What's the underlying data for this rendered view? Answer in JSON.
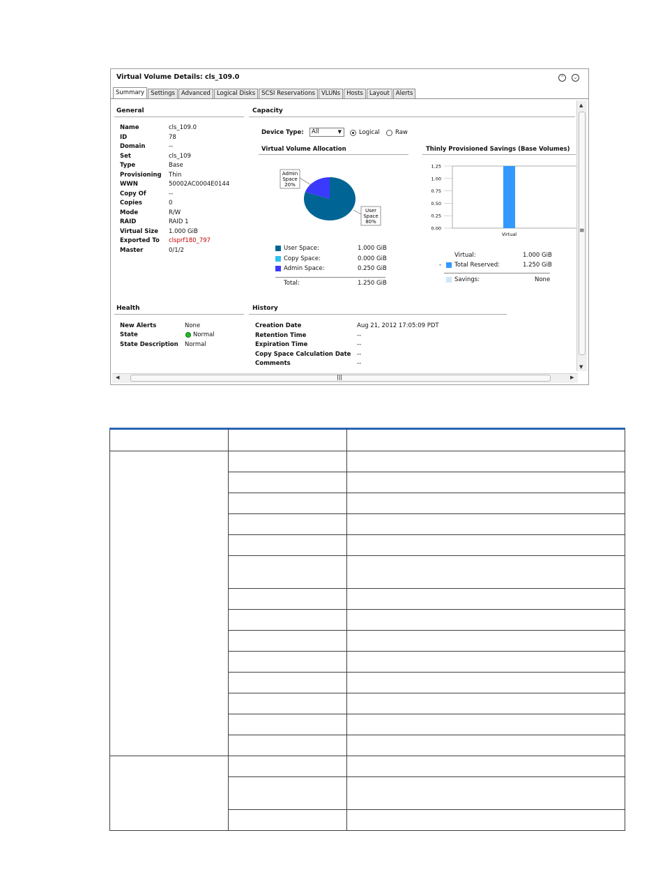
{
  "window": {
    "title": "Virtual Volume Details: cls_109.0",
    "tabs": [
      "Summary",
      "Settings",
      "Advanced",
      "Logical Disks",
      "SCSI Reservations",
      "VLUNs",
      "Hosts",
      "Layout",
      "Alerts"
    ],
    "active_tab": "Summary"
  },
  "general": {
    "title": "General",
    "rows": [
      {
        "label": "Name",
        "value": "cls_109.0"
      },
      {
        "label": "ID",
        "value": "78"
      },
      {
        "label": "Domain",
        "value": "--"
      },
      {
        "label": "Set",
        "value": "cls_109"
      },
      {
        "label": "Type",
        "value": "Base"
      },
      {
        "label": "Provisioning",
        "value": "Thin"
      },
      {
        "label": "WWN",
        "value": "50002AC0004E0144"
      },
      {
        "label": "Copy Of",
        "value": "--"
      },
      {
        "label": "Copies",
        "value": "0"
      },
      {
        "label": "Mode",
        "value": "R/W"
      },
      {
        "label": "RAID",
        "value": "RAID 1"
      },
      {
        "label": "Virtual Size",
        "value": "1.000 GiB"
      },
      {
        "label": "Exported To",
        "value": "clsprf180_797"
      },
      {
        "label": "Master",
        "value": "0/1/2"
      }
    ]
  },
  "capacity": {
    "title": "Capacity",
    "device_type_label": "Device Type:",
    "device_type_value": "All",
    "radio_logical": "Logical",
    "radio_raw": "Raw",
    "allocation_title": "Virtual Volume Allocation",
    "savings_title": "Thinly Provisioned Savings (Base Volumes)",
    "legend": [
      {
        "label": "User Space:",
        "value": "1.000 GiB",
        "color": "#006594"
      },
      {
        "label": "Copy Space:",
        "value": "0.000 GiB",
        "color": "#33c0f0"
      },
      {
        "label": "Admin Space:",
        "value": "0.250 GiB",
        "color": "#3a3aff"
      }
    ],
    "total_label": "Total:",
    "total_value": "1.250 GiB",
    "savings_legend": [
      {
        "label": "Virtual:",
        "value": "1.000 GiB"
      },
      {
        "label": "Total Reserved:",
        "value": "1.250 GiB",
        "color": "#3399ff"
      },
      {
        "label": "Savings:",
        "value": "None",
        "color": "#cfe6f7"
      }
    ]
  },
  "chart_data": [
    {
      "type": "pie",
      "title": "Virtual Volume Allocation",
      "categories": [
        "User Space",
        "Admin Space"
      ],
      "values": [
        80,
        20
      ],
      "labels": [
        "User\nSpace\n80%",
        "Admin\nSpace\n20%"
      ],
      "label_lines": {
        "admin": [
          "Admin",
          "Space",
          "20%"
        ],
        "user": [
          "User",
          "Space",
          "80%"
        ]
      },
      "colors": [
        "#006594",
        "#3a3aff"
      ]
    },
    {
      "type": "bar",
      "title": "Thinly Provisioned Savings (Base Volumes)",
      "categories": [
        "Virtual"
      ],
      "values": [
        1.25
      ],
      "ylim": [
        0,
        1.25
      ],
      "yticks": [
        "0.00",
        "0.25",
        "0.50",
        "0.75",
        "1.00",
        "1.25"
      ],
      "color": "#3399ff"
    }
  ],
  "health": {
    "title": "Health",
    "rows": [
      {
        "label": "New Alerts",
        "value": "None"
      },
      {
        "label": "State",
        "value": "Normal"
      },
      {
        "label": "State Description",
        "value": "Normal"
      }
    ],
    "state_color": "#22bb22"
  },
  "history": {
    "title": "History",
    "rows": [
      {
        "label": "Creation Date",
        "value": "Aug 21, 2012 17:05:09 PDT"
      },
      {
        "label": "Retention Time",
        "value": "--"
      },
      {
        "label": "Expiration Time",
        "value": "--"
      },
      {
        "label": "Copy Space Calculation Date",
        "value": "--"
      },
      {
        "label": "Comments",
        "value": "--"
      }
    ]
  },
  "scroll": {
    "h_grip": "|||",
    "v_grip": "≡"
  }
}
